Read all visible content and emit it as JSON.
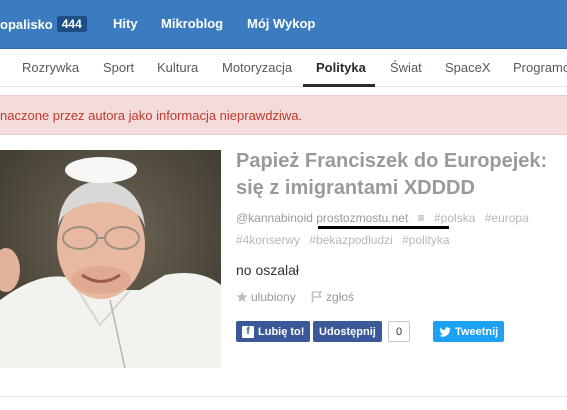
{
  "header": {
    "logo_text": "opalisko",
    "logo_count": "444",
    "nav": [
      "Hity",
      "Mikroblog",
      "Mój Wykop"
    ]
  },
  "tabs": [
    "Rozrywka",
    "Sport",
    "Kultura",
    "Motoryzacja",
    "Polityka",
    "Świat",
    "SpaceX",
    "Programo"
  ],
  "active_tab": "Polityka",
  "warning": {
    "text": "naczone przez autora jako informacja nieprawdziwa."
  },
  "article": {
    "title_line1": "Papież Franciszek do Europejek:",
    "title_line2": "się z imigrantami XDDDD",
    "author": "@kannabinoid",
    "domain": "prostozmostu.net",
    "tags_line1": [
      "#polska",
      "#europa"
    ],
    "tags_line2": [
      "#4konserwy",
      "#bekazpodludzi",
      "#polityka"
    ],
    "body": "no oszalał",
    "favourite_label": "ulubiony",
    "report_label": "zgłoś"
  },
  "share": {
    "fb_like": "Lubię to!",
    "fb_share": "Udostępnij",
    "share_count": "0",
    "tweet": "Tweetnij"
  },
  "colors": {
    "topbar": "#3b7bbf",
    "warning_bg": "#f5dcdc",
    "warning_text": "#c0392b",
    "facebook": "#3b5998",
    "twitter": "#1da1f2"
  }
}
